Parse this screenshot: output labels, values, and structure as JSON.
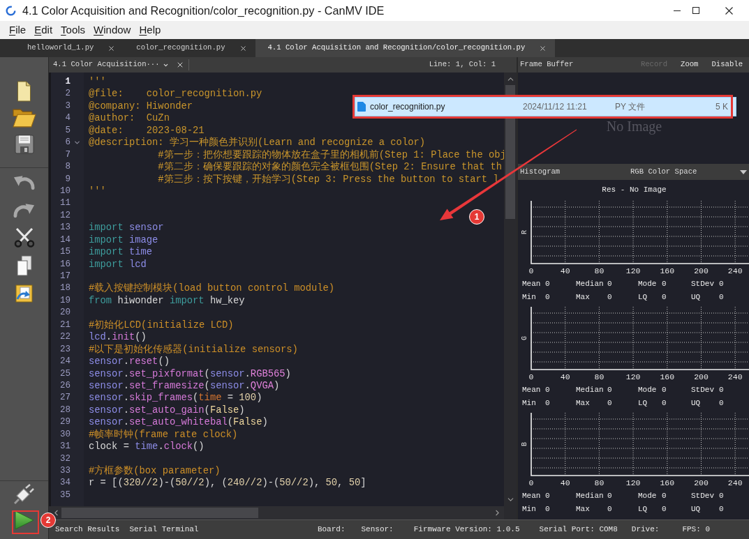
{
  "window": {
    "title": "4.1 Color Acquisition and Recognition/color_recognition.py - CanMV IDE"
  },
  "menu": [
    "File",
    "Edit",
    "Tools",
    "Window",
    "Help"
  ],
  "tabs": [
    {
      "label": "helloworld_1.py",
      "selected": false
    },
    {
      "label": "color_recognition.py",
      "selected": false
    },
    {
      "label": "4.1 Color Acquisition and Recognition/color_recognition.py",
      "selected": true
    }
  ],
  "editor": {
    "document": "4.1 Color Acquisition···",
    "cursor": "Line: 1, Col: 1",
    "lines": [
      {
        "number": "1",
        "current": true,
        "fold_marker": false,
        "tokens": [
          {
            "kind": "docstring",
            "text": "'''"
          }
        ]
      },
      {
        "number": "2",
        "current": false,
        "fold_marker": false,
        "tokens": [
          {
            "kind": "docstring",
            "text": "@file:    color_recognition.py"
          }
        ]
      },
      {
        "number": "3",
        "current": false,
        "fold_marker": false,
        "tokens": [
          {
            "kind": "docstring",
            "text": "@company: Hiwonder"
          }
        ]
      },
      {
        "number": "4",
        "current": false,
        "fold_marker": false,
        "tokens": [
          {
            "kind": "docstring",
            "text": "@author:  CuZn"
          }
        ]
      },
      {
        "number": "5",
        "current": false,
        "fold_marker": false,
        "tokens": [
          {
            "kind": "docstring",
            "text": "@date:    2023-08-21"
          }
        ]
      },
      {
        "number": "6",
        "current": false,
        "fold_marker": true,
        "tokens": [
          {
            "kind": "docstring",
            "text": "@description: 学习一种颜色并识别(Learn and recognize a color)"
          }
        ]
      },
      {
        "number": "7",
        "current": false,
        "fold_marker": false,
        "tokens": [
          {
            "kind": "docstring",
            "text": "            #第一步：把你想要跟踪的物体放在盒子里的相机前(Step 1: Place the obj"
          }
        ]
      },
      {
        "number": "8",
        "current": false,
        "fold_marker": false,
        "tokens": [
          {
            "kind": "docstring",
            "text": "            #第二步：确保要跟踪的对象的颜色完全被框包围(Step 2: Ensure that th"
          }
        ]
      },
      {
        "number": "9",
        "current": false,
        "fold_marker": false,
        "tokens": [
          {
            "kind": "docstring",
            "text": "            #第三步：按下按键，开始学习(Step 3: Press the button to start l"
          }
        ]
      },
      {
        "number": "10",
        "current": false,
        "fold_marker": false,
        "tokens": [
          {
            "kind": "docstring",
            "text": "'''"
          }
        ]
      },
      {
        "number": "11",
        "current": false,
        "fold_marker": false
      },
      {
        "number": "12",
        "current": false,
        "fold_marker": false
      },
      {
        "number": "13",
        "current": false,
        "fold_marker": false,
        "tokens": [
          {
            "kind": "keyword",
            "text": "import"
          },
          {
            "kind": "module",
            "text": " sensor"
          }
        ]
      },
      {
        "number": "14",
        "current": false,
        "fold_marker": false,
        "tokens": [
          {
            "kind": "keyword",
            "text": "import"
          },
          {
            "kind": "module",
            "text": " image"
          }
        ]
      },
      {
        "number": "15",
        "current": false,
        "fold_marker": false,
        "tokens": [
          {
            "kind": "keyword",
            "text": "import"
          },
          {
            "kind": "module",
            "text": " time"
          }
        ]
      },
      {
        "number": "16",
        "current": false,
        "fold_marker": false,
        "tokens": [
          {
            "kind": "keyword",
            "text": "import"
          },
          {
            "kind": "module",
            "text": " lcd"
          }
        ]
      },
      {
        "number": "17",
        "current": false,
        "fold_marker": false
      },
      {
        "number": "18",
        "current": false,
        "fold_marker": false,
        "tokens": [
          {
            "kind": "comment",
            "text": "#载入按键控制模块(load button control module)"
          }
        ]
      },
      {
        "number": "19",
        "current": false,
        "fold_marker": false,
        "tokens": [
          {
            "kind": "keyword",
            "text": "from"
          },
          {
            "kind": "name",
            "text": " hiwonder"
          },
          {
            "kind": "keyword",
            "text": " import"
          },
          {
            "kind": "name",
            "text": " hw_key"
          }
        ]
      },
      {
        "number": "20",
        "current": false,
        "fold_marker": false
      },
      {
        "number": "21",
        "current": false,
        "fold_marker": false,
        "tokens": [
          {
            "kind": "comment",
            "text": "#初始化LCD(initialize LCD)"
          }
        ]
      },
      {
        "number": "22",
        "current": false,
        "fold_marker": false,
        "tokens": [
          {
            "kind": "module",
            "text": "lcd"
          },
          {
            "kind": "punct",
            "text": "."
          },
          {
            "kind": "method",
            "text": "init"
          },
          {
            "kind": "punct",
            "text": "()"
          }
        ]
      },
      {
        "number": "23",
        "current": false,
        "fold_marker": false,
        "tokens": [
          {
            "kind": "comment",
            "text": "#以下是初始化传感器(initialize sensors)"
          }
        ]
      },
      {
        "number": "24",
        "current": false,
        "fold_marker": false,
        "tokens": [
          {
            "kind": "module",
            "text": "sensor"
          },
          {
            "kind": "punct",
            "text": "."
          },
          {
            "kind": "method",
            "text": "reset"
          },
          {
            "kind": "punct",
            "text": "()"
          }
        ]
      },
      {
        "number": "25",
        "current": false,
        "fold_marker": false,
        "tokens": [
          {
            "kind": "module",
            "text": "sensor"
          },
          {
            "kind": "punct",
            "text": "."
          },
          {
            "kind": "method",
            "text": "set_pixformat"
          },
          {
            "kind": "punct",
            "text": "("
          },
          {
            "kind": "module",
            "text": "sensor"
          },
          {
            "kind": "punct",
            "text": "."
          },
          {
            "kind": "constant",
            "text": "RGB565"
          },
          {
            "kind": "punct",
            "text": ")"
          }
        ]
      },
      {
        "number": "26",
        "current": false,
        "fold_marker": false,
        "tokens": [
          {
            "kind": "module",
            "text": "sensor"
          },
          {
            "kind": "punct",
            "text": "."
          },
          {
            "kind": "method",
            "text": "set_framesize"
          },
          {
            "kind": "punct",
            "text": "("
          },
          {
            "kind": "module",
            "text": "sensor"
          },
          {
            "kind": "punct",
            "text": "."
          },
          {
            "kind": "constant",
            "text": "QVGA"
          },
          {
            "kind": "punct",
            "text": ")"
          }
        ]
      },
      {
        "number": "27",
        "current": false,
        "fold_marker": false,
        "tokens": [
          {
            "kind": "module",
            "text": "sensor"
          },
          {
            "kind": "punct",
            "text": "."
          },
          {
            "kind": "method",
            "text": "skip_frames"
          },
          {
            "kind": "punct",
            "text": "("
          },
          {
            "kind": "param",
            "text": "time"
          },
          {
            "kind": "punct",
            "text": " = "
          },
          {
            "kind": "number",
            "text": "100"
          },
          {
            "kind": "punct",
            "text": ")"
          }
        ]
      },
      {
        "number": "28",
        "current": false,
        "fold_marker": false,
        "tokens": [
          {
            "kind": "module",
            "text": "sensor"
          },
          {
            "kind": "punct",
            "text": "."
          },
          {
            "kind": "method",
            "text": "set_auto_gain"
          },
          {
            "kind": "punct",
            "text": "("
          },
          {
            "kind": "bool",
            "text": "False"
          },
          {
            "kind": "punct",
            "text": ")"
          }
        ]
      },
      {
        "number": "29",
        "current": false,
        "fold_marker": false,
        "tokens": [
          {
            "kind": "module",
            "text": "sensor"
          },
          {
            "kind": "punct",
            "text": "."
          },
          {
            "kind": "method",
            "text": "set_auto_whitebal"
          },
          {
            "kind": "punct",
            "text": "("
          },
          {
            "kind": "bool",
            "text": "False"
          },
          {
            "kind": "punct",
            "text": ")"
          }
        ]
      },
      {
        "number": "30",
        "current": false,
        "fold_marker": false,
        "tokens": [
          {
            "kind": "comment",
            "text": "#帧率时钟(frame rate clock)"
          }
        ]
      },
      {
        "number": "31",
        "current": false,
        "fold_marker": false,
        "tokens": [
          {
            "kind": "name",
            "text": "clock"
          },
          {
            "kind": "punct",
            "text": " = "
          },
          {
            "kind": "module",
            "text": "time"
          },
          {
            "kind": "punct",
            "text": "."
          },
          {
            "kind": "method",
            "text": "clock"
          },
          {
            "kind": "punct",
            "text": "()"
          }
        ]
      },
      {
        "number": "32",
        "current": false,
        "fold_marker": false
      },
      {
        "number": "33",
        "current": false,
        "fold_marker": false,
        "tokens": [
          {
            "kind": "comment",
            "text": "#方框参数(box parameter)"
          }
        ]
      },
      {
        "number": "34",
        "current": false,
        "fold_marker": false,
        "tokens": [
          {
            "kind": "name",
            "text": "r"
          },
          {
            "kind": "punct",
            "text": " = [("
          },
          {
            "kind": "number",
            "text": "320//2"
          },
          {
            "kind": "punct",
            "text": ")-("
          },
          {
            "kind": "number",
            "text": "50//2"
          },
          {
            "kind": "punct",
            "text": "), ("
          },
          {
            "kind": "number",
            "text": "240//2"
          },
          {
            "kind": "punct",
            "text": ")-("
          },
          {
            "kind": "number",
            "text": "50//2"
          },
          {
            "kind": "punct",
            "text": "), "
          },
          {
            "kind": "number",
            "text": "50"
          },
          {
            "kind": "punct",
            "text": ", "
          },
          {
            "kind": "number",
            "text": "50"
          },
          {
            "kind": "punct",
            "text": "]"
          }
        ]
      },
      {
        "number": "35",
        "current": false,
        "fold_marker": false
      }
    ]
  },
  "frame_buffer": {
    "title": "Frame Buffer",
    "actions": [
      {
        "label": "Record",
        "disabled": true
      },
      {
        "label": "Zoom",
        "disabled": false
      },
      {
        "label": "Disable",
        "disabled": false
      }
    ],
    "message": "No Image"
  },
  "histogram": {
    "title": "Histogram",
    "color_space": "RGB Color Space",
    "caption": "Res - No Image",
    "channels": [
      {
        "axis_label": "R",
        "ticks": [
          "0",
          "40",
          "80",
          "120",
          "160",
          "200",
          "240"
        ],
        "stats": [
          {
            "label": "Mean",
            "value": "0"
          },
          {
            "label": "Median",
            "value": "0"
          },
          {
            "label": "Mode",
            "value": "0"
          },
          {
            "label": "StDev",
            "value": "0"
          },
          {
            "label": "Min",
            "value": "0"
          },
          {
            "label": "Max",
            "value": "0"
          },
          {
            "label": "LQ",
            "value": "0"
          },
          {
            "label": "UQ",
            "value": "0"
          }
        ]
      },
      {
        "axis_label": "G",
        "ticks": [
          "0",
          "40",
          "80",
          "120",
          "160",
          "200",
          "240"
        ],
        "stats": [
          {
            "label": "Mean",
            "value": "0"
          },
          {
            "label": "Median",
            "value": "0"
          },
          {
            "label": "Mode",
            "value": "0"
          },
          {
            "label": "StDev",
            "value": "0"
          },
          {
            "label": "Min",
            "value": "0"
          },
          {
            "label": "Max",
            "value": "0"
          },
          {
            "label": "LQ",
            "value": "0"
          },
          {
            "label": "UQ",
            "value": "0"
          }
        ]
      },
      {
        "axis_label": "B",
        "ticks": [
          "0",
          "40",
          "80",
          "120",
          "160",
          "200",
          "240"
        ],
        "stats": [
          {
            "label": "Mean",
            "value": "0"
          },
          {
            "label": "Median",
            "value": "0"
          },
          {
            "label": "Mode",
            "value": "0"
          },
          {
            "label": "StDev",
            "value": "0"
          },
          {
            "label": "Min",
            "value": "0"
          },
          {
            "label": "Max",
            "value": "0"
          },
          {
            "label": "LQ",
            "value": "0"
          },
          {
            "label": "UQ",
            "value": "0"
          }
        ]
      }
    ]
  },
  "status_bar": {
    "tabs": [
      "Search Results",
      "Serial Terminal"
    ],
    "items": [
      "Board:",
      "Sensor:",
      "Firmware Version: 1.0.5",
      "Serial Port: COM8",
      "Drive:",
      "FPS: 0"
    ]
  },
  "file_row": {
    "name": "color_recognition.py",
    "modified": "2024/11/12 11:21",
    "type": "PY 文件",
    "size": "5 K"
  },
  "annotations": [
    {
      "label": "1"
    },
    {
      "label": "2"
    }
  ]
}
